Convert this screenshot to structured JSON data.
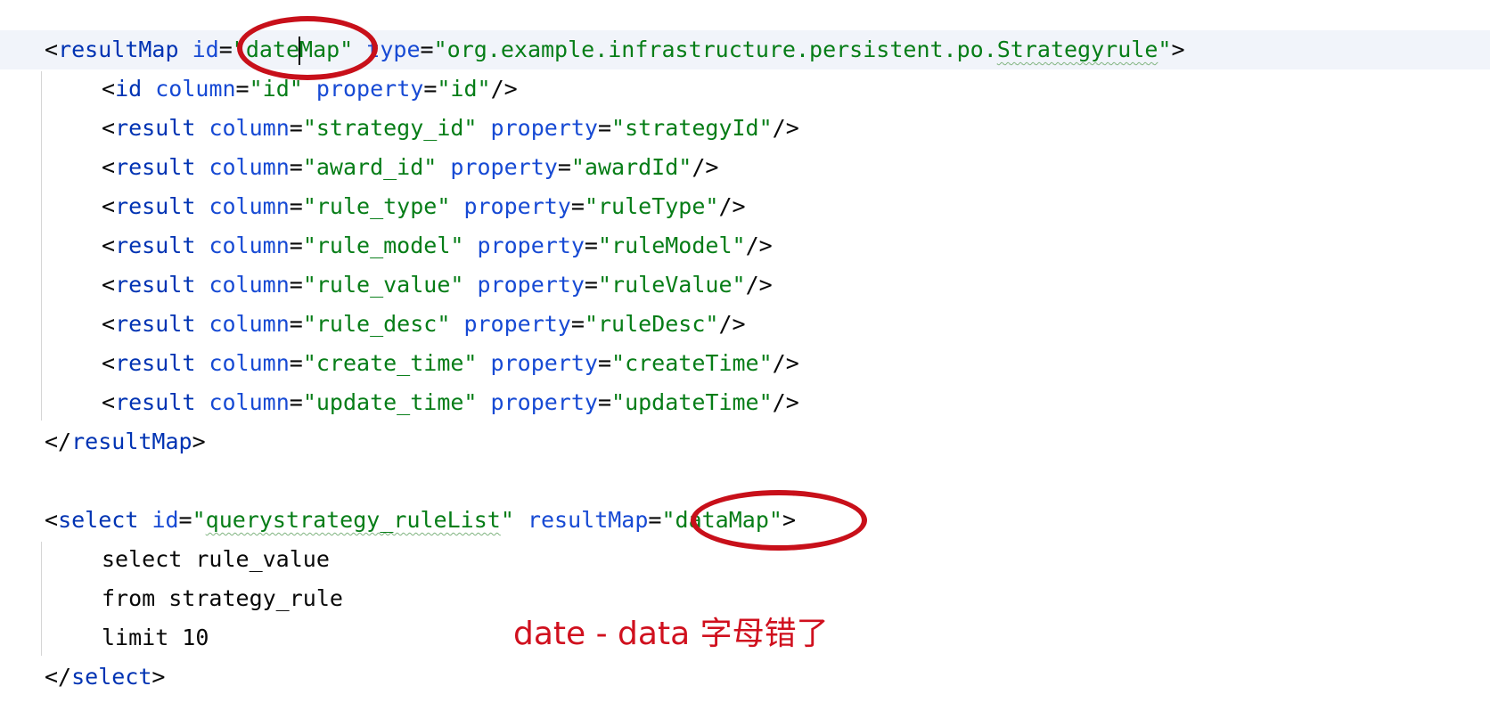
{
  "editor": {
    "language": "xml",
    "colors": {
      "background": "#ffffff",
      "current_line": "#f1f4fa",
      "tag": "#0033b3",
      "attribute": "#174ad4",
      "value": "#067d17",
      "plain": "#080808",
      "annotation_red": "#c8101a"
    },
    "result_map": {
      "open": {
        "tag": "resultMap",
        "id_attr": "id",
        "id_value_before_caret": "\"date",
        "id_value_after_caret": "Map\"",
        "type_attr": "type",
        "type_value_prefix": "\"org.example.infrastructure.persistent.po.",
        "type_value_flagged": "Strategyrule",
        "type_value_suffix": "\""
      },
      "id_row": {
        "tag": "id",
        "column": "\"id\"",
        "property": "\"id\""
      },
      "result_rows": [
        {
          "tag": "result",
          "column": "\"strategy_id\"",
          "property": "\"strategyId\""
        },
        {
          "tag": "result",
          "column": "\"award_id\"",
          "property": "\"awardId\""
        },
        {
          "tag": "result",
          "column": "\"rule_type\"",
          "property": "\"ruleType\""
        },
        {
          "tag": "result",
          "column": "\"rule_model\"",
          "property": "\"ruleModel\""
        },
        {
          "tag": "result",
          "column": "\"rule_value\"",
          "property": "\"ruleValue\""
        },
        {
          "tag": "result",
          "column": "\"rule_desc\"",
          "property": "\"ruleDesc\""
        },
        {
          "tag": "result",
          "column": "\"create_time\"",
          "property": "\"createTime\""
        },
        {
          "tag": "result",
          "column": "\"update_time\"",
          "property": "\"updateTime\""
        }
      ],
      "close_tag": "resultMap"
    },
    "select_block": {
      "tag": "select",
      "id_attr": "id",
      "id_value_quote_open": "\"",
      "id_value_flagged": "querystrategy_ruleList",
      "id_value_quote_close": "\"",
      "result_map_attr": "resultMap",
      "result_map_value": "\"dataMap\"",
      "sql_lines": [
        "select rule_value",
        "from strategy_rule",
        "limit 10"
      ],
      "close_tag": "select"
    }
  },
  "annotation": {
    "note": "date - data 字母错了",
    "marks": [
      "red-circle-datemap",
      "red-circle-datamap"
    ]
  }
}
